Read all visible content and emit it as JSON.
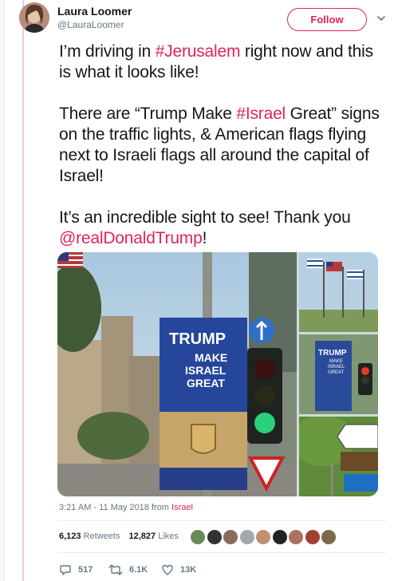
{
  "author": {
    "display_name": "Laura Loomer",
    "handle": "@LauraLoomer",
    "avatar_icon": "profile-photo"
  },
  "follow_button": {
    "label": "Follow",
    "color": "#e0245e"
  },
  "more_menu_icon": "chevron-down-icon",
  "tweet": {
    "p1_a": "I’m driving in ",
    "p1_hashtag": "#Jerusalem",
    "p1_b": " right now and this is what it looks like!",
    "p2_a": "There are “Trump Make ",
    "p2_hashtag": "#Israel",
    "p2_b": " Great” signs on the traffic lights, & American flags flying next to Israeli flags all around the capital of Israel!",
    "p3_a": "It’s an incredible sight to see! Thank you ",
    "p3_mention": "@realDonaldTrump",
    "p3_b": "!"
  },
  "media": {
    "main_sign": {
      "line1": "TRUMP",
      "line2": "MAKE",
      "line3": "ISRAEL",
      "line4": "GREAT"
    },
    "thumb_sign": {
      "line1": "TRUMP",
      "line2": "MAKE",
      "line3": "ISRAEL",
      "line4": "GREAT"
    }
  },
  "timestamp": {
    "text": "3:21 AM - 11 May 2018 from ",
    "location": "Israel"
  },
  "stats": {
    "retweets_count": "6,123",
    "retweets_label": "Retweets",
    "likes_count": "12,827",
    "likes_label": "Likes"
  },
  "liker_colors": [
    "#6a8a5a",
    "#333333",
    "#8a6a5a",
    "#a0a8b0",
    "#c09070",
    "#222222",
    "#b07060",
    "#a04030",
    "#7a6a4a"
  ],
  "actions": {
    "replies": "517",
    "retweets": "6.1K",
    "likes": "13K"
  },
  "colors": {
    "accent": "#e0245e",
    "secondary_text": "#657786"
  }
}
